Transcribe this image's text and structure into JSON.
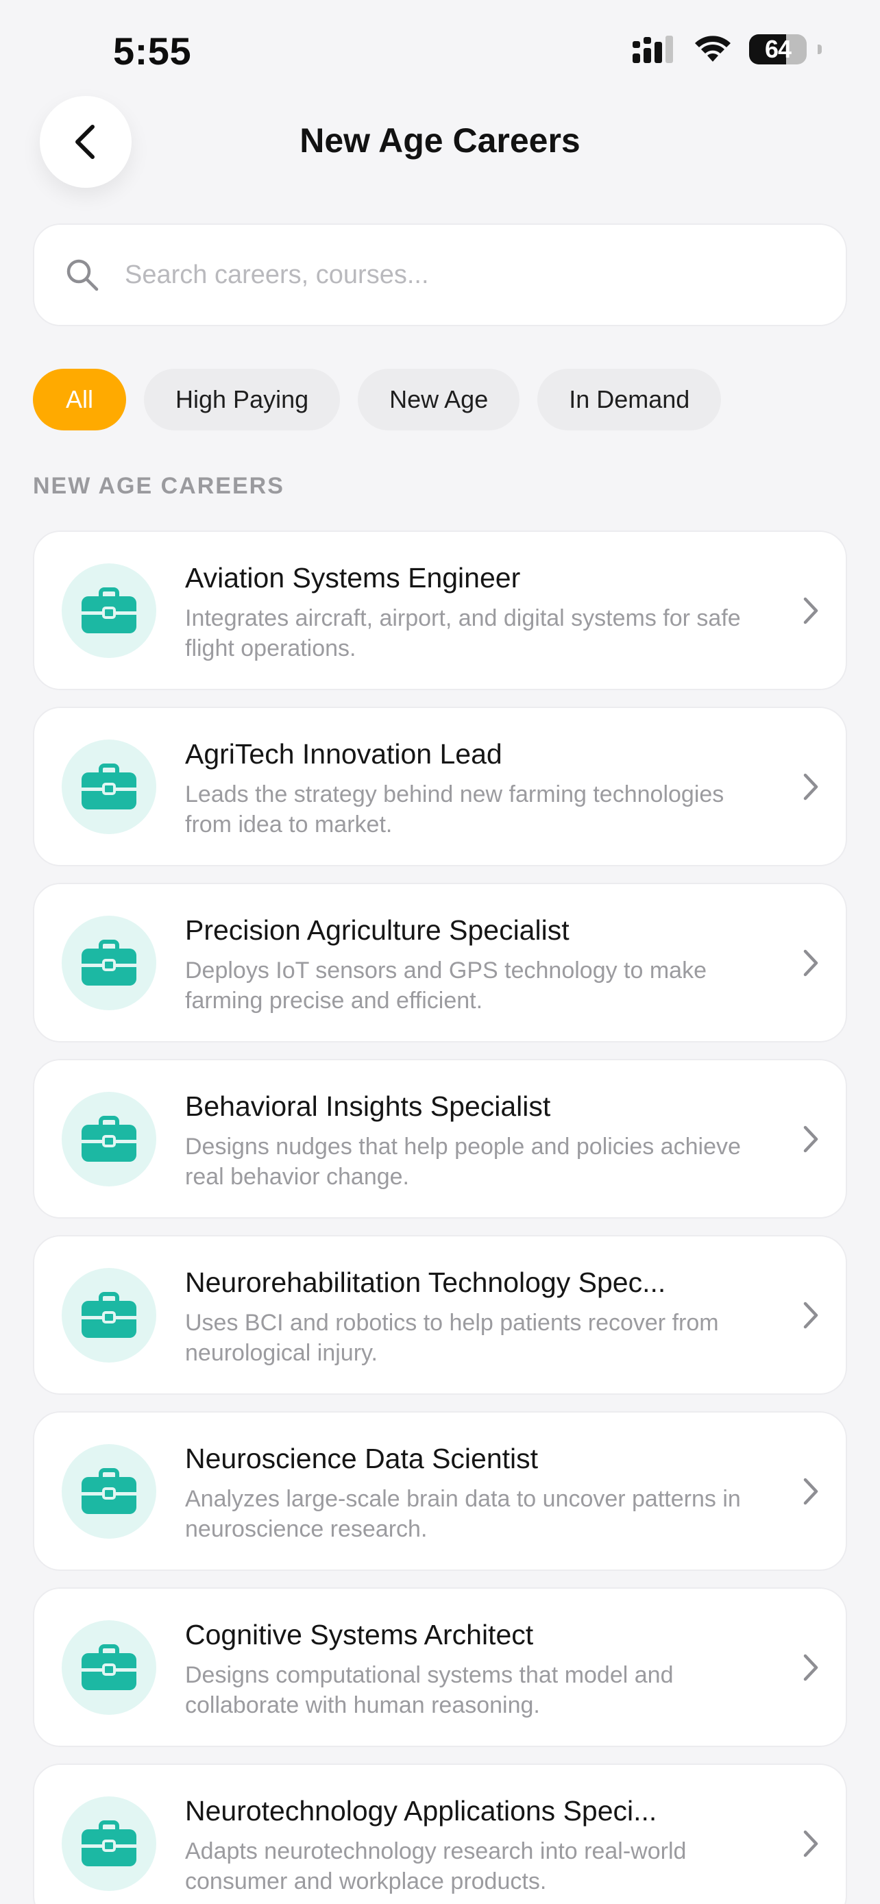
{
  "status_bar": {
    "time": "5:55",
    "battery_level": "64",
    "battery_fraction": 0.64,
    "icons": [
      "cellular-signal-icon",
      "wifi-icon",
      "battery-icon"
    ]
  },
  "header": {
    "title": "New Age Careers",
    "back_icon": "chevron-left-icon"
  },
  "search": {
    "placeholder": "Search careers, courses...",
    "value": "",
    "icon": "search-icon"
  },
  "filters": {
    "chips": [
      {
        "label": "All",
        "active": true
      },
      {
        "label": "High Paying",
        "active": false
      },
      {
        "label": "New Age",
        "active": false
      },
      {
        "label": "In Demand",
        "active": false
      }
    ]
  },
  "section": {
    "label": "NEW AGE CAREERS"
  },
  "careers": [
    {
      "title": "Aviation Systems Engineer",
      "description": "Integrates aircraft, airport, and digital systems for safe flight operations.",
      "icon": "briefcase-icon"
    },
    {
      "title": "AgriTech Innovation Lead",
      "description": "Leads the strategy behind new farming technologies from idea to market.",
      "icon": "briefcase-icon"
    },
    {
      "title": "Precision Agriculture Specialist",
      "description": "Deploys IoT sensors and GPS technology to make farming precise and efficient.",
      "icon": "briefcase-icon"
    },
    {
      "title": "Behavioral Insights Specialist",
      "description": "Designs nudges that help people and policies achieve real behavior change.",
      "icon": "briefcase-icon"
    },
    {
      "title": "Neurorehabilitation Technology Spec...",
      "description": "Uses BCI and robotics to help patients recover from neurological injury.",
      "icon": "briefcase-icon"
    },
    {
      "title": "Neuroscience Data Scientist",
      "description": "Analyzes large-scale brain data to uncover patterns in neuroscience research.",
      "icon": "briefcase-icon"
    },
    {
      "title": "Cognitive Systems Architect",
      "description": "Designs computational systems that model and collaborate with human reasoning.",
      "icon": "briefcase-icon"
    },
    {
      "title": "Neurotechnology Applications Speci...",
      "description": "Adapts neurotechnology research into real-world consumer and workplace products.",
      "icon": "briefcase-icon"
    }
  ],
  "colors": {
    "accent": "#FFAA00",
    "teal": "#1CB8A3",
    "teal_light": "#E2F6F3",
    "background": "#F5F5F7"
  }
}
